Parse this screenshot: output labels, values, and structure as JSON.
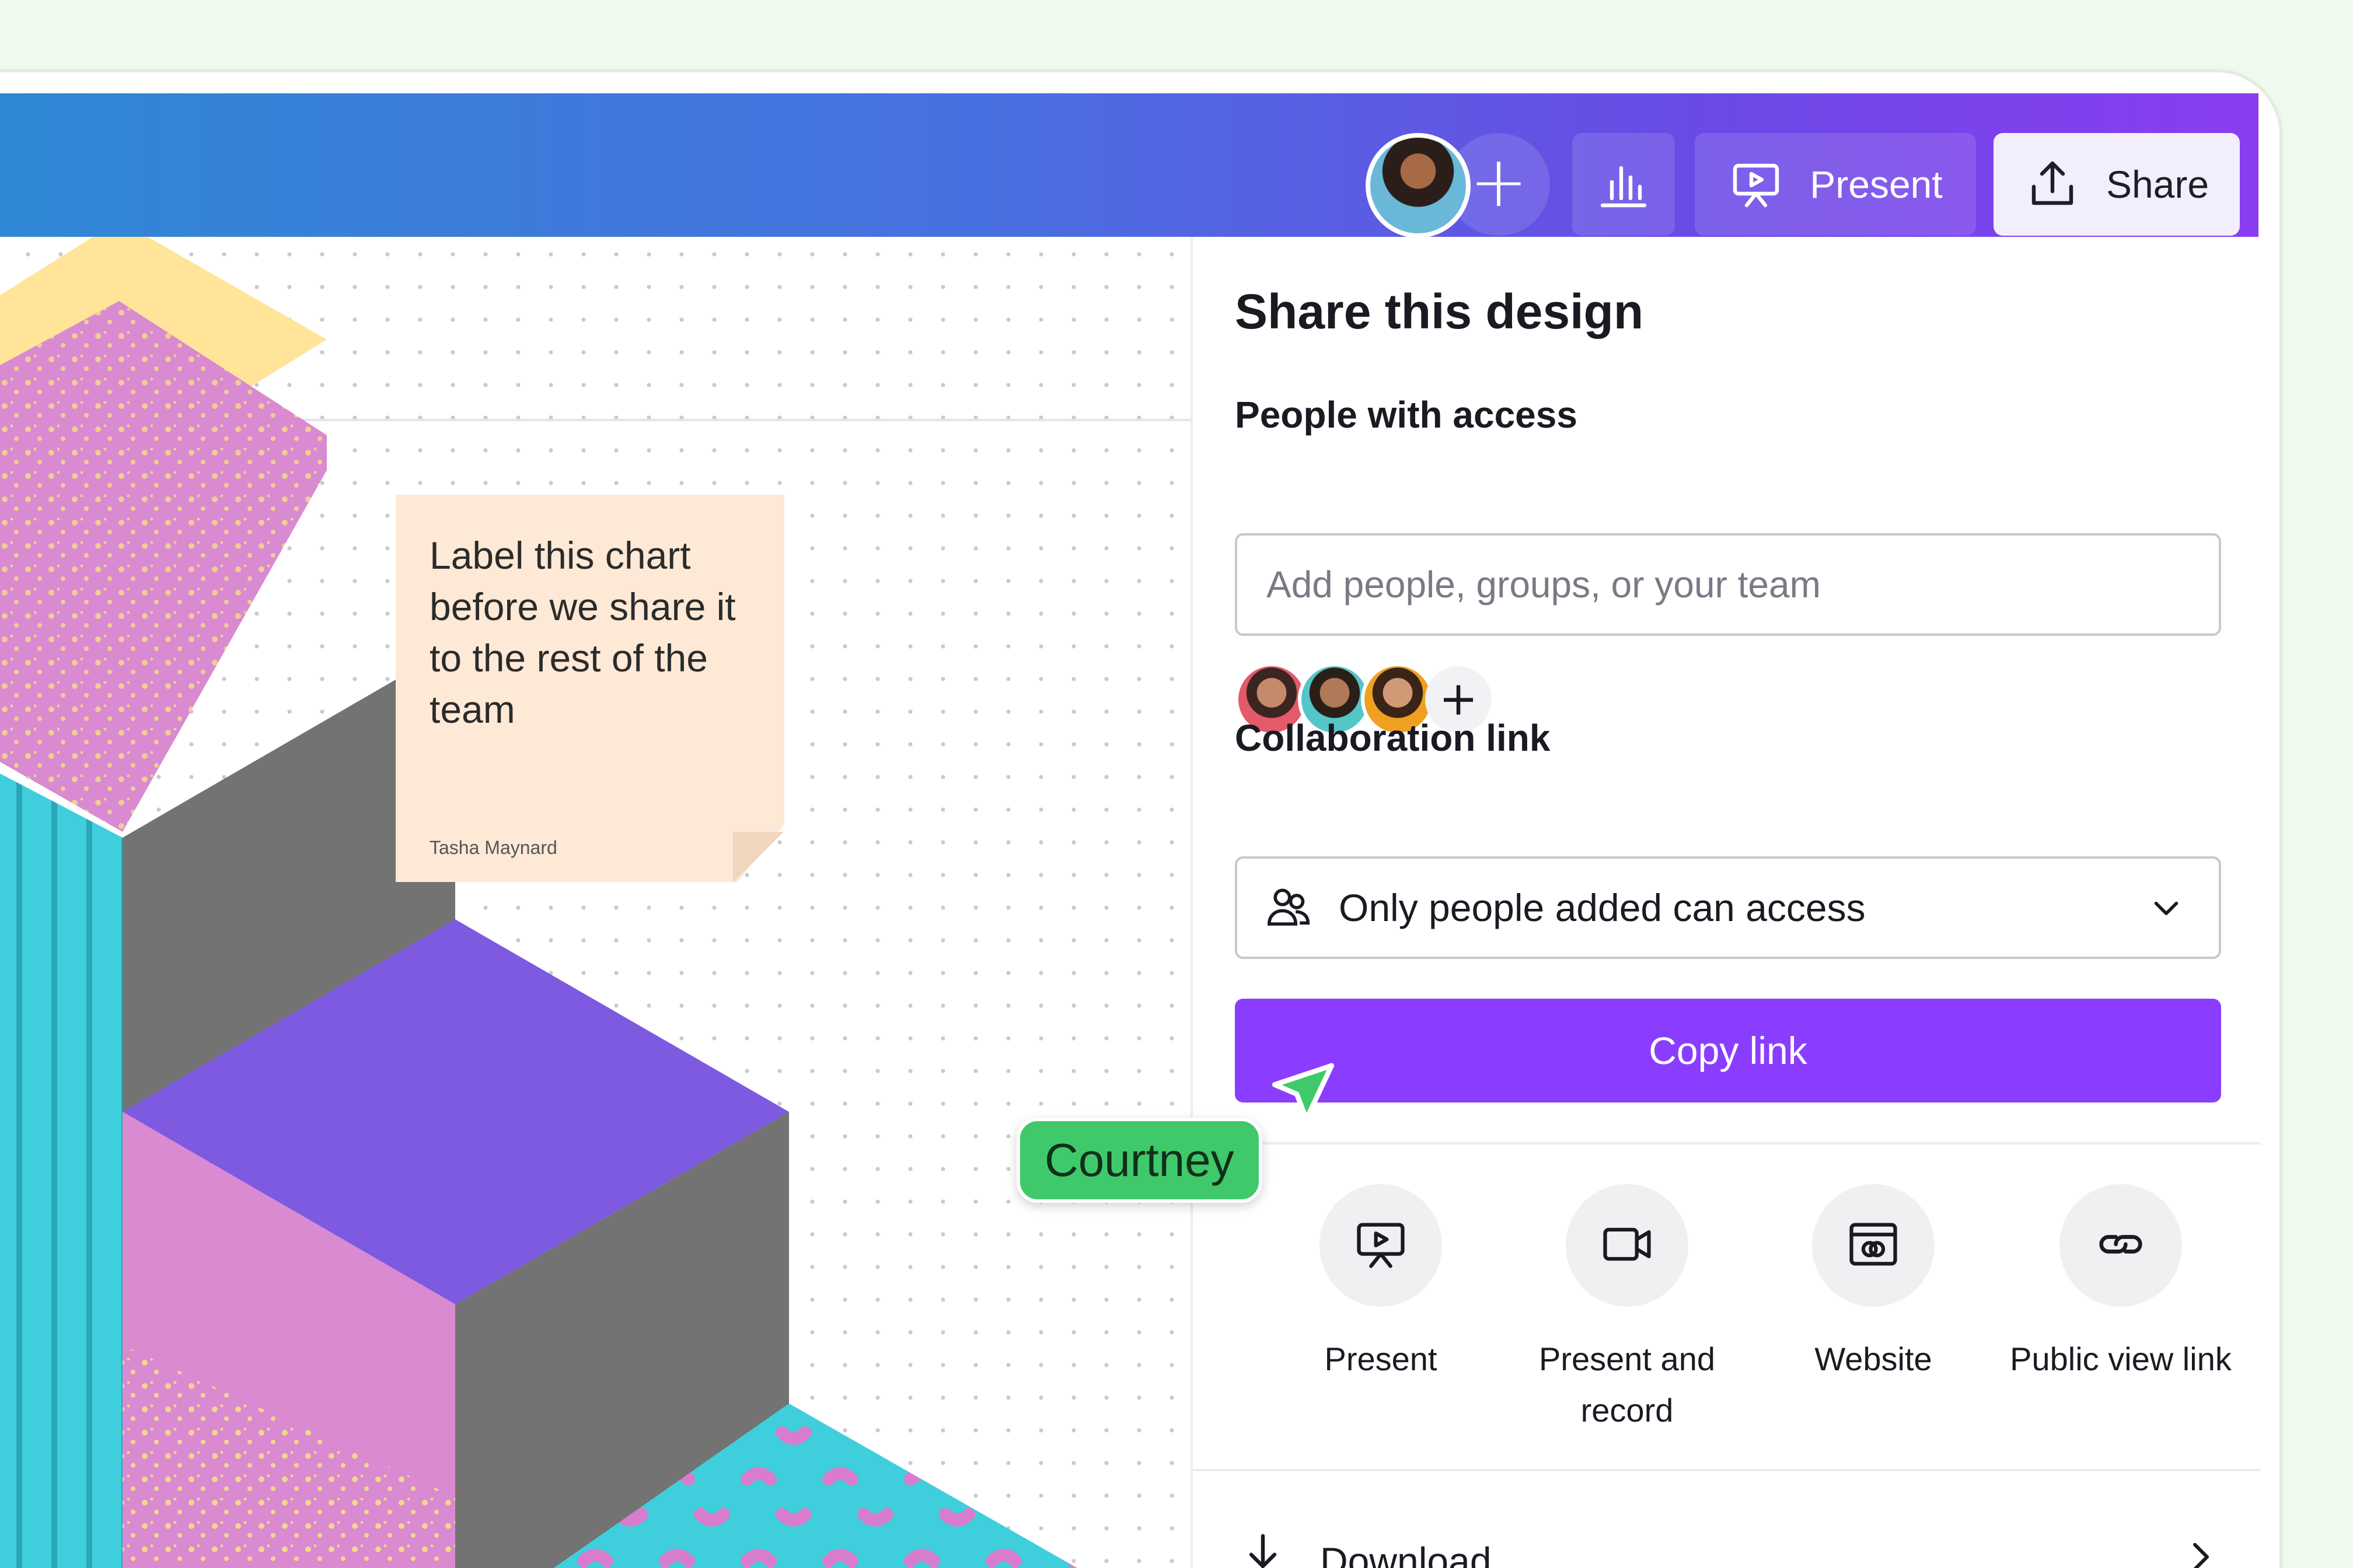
{
  "colors": {
    "topbar_start": "#2f88d6",
    "topbar_end": "#8a3cf0",
    "primary": "#8b3dff",
    "cursor_tag": "#3fc96a",
    "sticky": "#fde9d6"
  },
  "toolbar": {
    "add_collaborator": "+",
    "present_label": "Present",
    "share_label": "Share"
  },
  "sticky_note": {
    "text": "Label this chart before we share it to the rest of the team",
    "author": "Tasha Maynard"
  },
  "cursor": {
    "name": "Courtney"
  },
  "share_panel": {
    "title": "Share this design",
    "people_label": "People with access",
    "people_placeholder": "Add people, groups, or your team",
    "add_person": "+",
    "collab_label": "Collaboration link",
    "access_value": "Only people added can access",
    "copy_link": "Copy link",
    "options": [
      {
        "label": "Present",
        "icon": "present-icon"
      },
      {
        "label": "Present and record",
        "icon": "video-camera-icon"
      },
      {
        "label": "Website",
        "icon": "website-icon"
      },
      {
        "label": "Public view link",
        "icon": "link-icon"
      }
    ],
    "download_label": "Download"
  }
}
